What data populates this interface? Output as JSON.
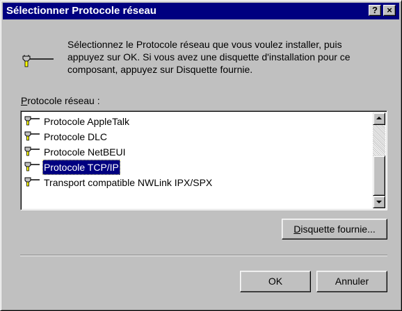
{
  "window": {
    "title": "Sélectionner Protocole réseau",
    "help_label": "?",
    "close_label": "×"
  },
  "intro": {
    "lines": [
      "Sélectionnez le Protocole réseau que vous voulez installer, puis",
      "appuyez sur OK. Si vous avez une disquette d'installation pour ce",
      "composant, appuyez sur Disquette fournie."
    ]
  },
  "list": {
    "label_prefix": "P",
    "label_rest": "rotocole réseau :",
    "items": [
      {
        "label": "Protocole AppleTalk",
        "selected": false
      },
      {
        "label": "Protocole DLC",
        "selected": false
      },
      {
        "label": "Protocole NetBEUI",
        "selected": false
      },
      {
        "label": "Protocole TCP/IP",
        "selected": true
      },
      {
        "label": "Transport compatible NWLink IPX/SPX",
        "selected": false
      }
    ]
  },
  "buttons": {
    "disk_prefix": "D",
    "disk_rest": "isquette fournie...",
    "ok": "OK",
    "cancel": "Annuler"
  },
  "colors": {
    "titlebar": "#000080",
    "selection": "#000080",
    "face": "#c0c0c0"
  }
}
